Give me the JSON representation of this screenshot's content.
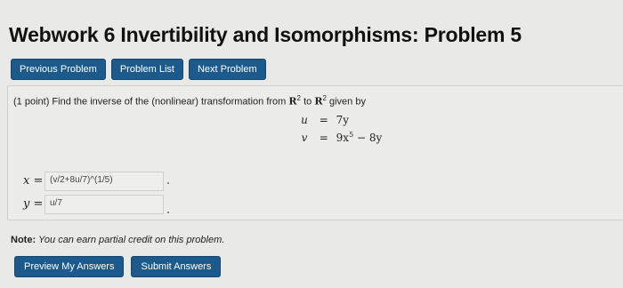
{
  "header": {
    "title": "Webwork 6 Invertibility and Isomorphisms: Problem 5"
  },
  "nav": {
    "previous_label": "Previous Problem",
    "list_label": "Problem List",
    "next_label": "Next Problem"
  },
  "problem": {
    "points": "(1 point)",
    "text_before": "Find the inverse of the (nonlinear) transformation from",
    "domain_symbol": "R",
    "domain_exp": "2",
    "to_word": "to",
    "codomain_symbol": "R",
    "codomain_exp": "2",
    "text_after": "given by",
    "equations": [
      {
        "lhs": "u",
        "eq": "=",
        "rhs_a": "7y",
        "rhs_b": "",
        "rhs_c": ""
      },
      {
        "lhs": "v",
        "eq": "=",
        "rhs_a": "9x",
        "rhs_b": "5",
        "rhs_c": " − 8y"
      }
    ]
  },
  "answers": {
    "x": {
      "label": "x =",
      "value": "(v/2+8u/7)^(1/5)"
    },
    "y": {
      "label": "y =",
      "value": "u/7"
    }
  },
  "note": {
    "bold": "Note:",
    "text": "You can earn partial credit on this problem."
  },
  "actions": {
    "preview_label": "Preview My Answers",
    "submit_label": "Submit Answers"
  }
}
